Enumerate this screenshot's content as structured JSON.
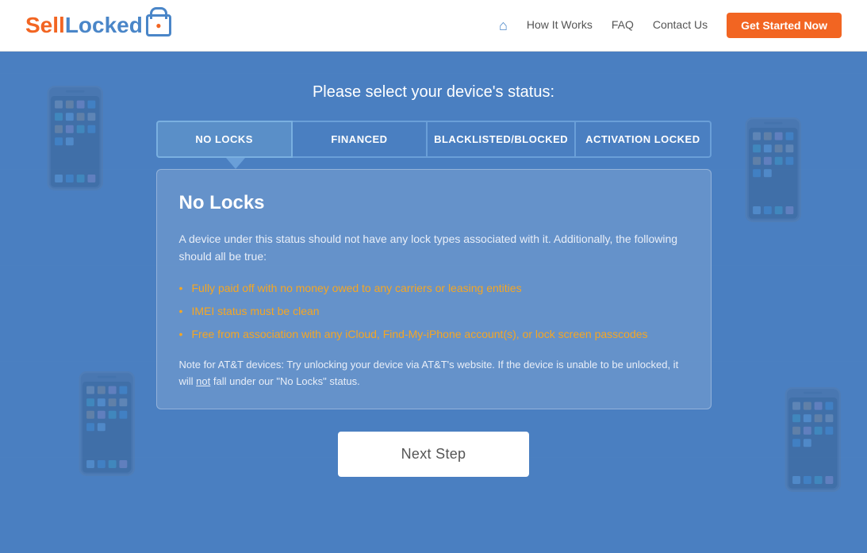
{
  "logo": {
    "sell": "Sell",
    "locked": "Locked"
  },
  "navbar": {
    "home_icon": "⌂",
    "how_it_works": "How It Works",
    "faq": "FAQ",
    "contact_us": "Contact Us",
    "get_started": "Get Started Now"
  },
  "main": {
    "page_title": "Please select your device's status:",
    "status_buttons": [
      {
        "label": "NO LOCKS",
        "active": true
      },
      {
        "label": "FINANCED",
        "active": false
      },
      {
        "label": "BLACKLISTED/BLOCKED",
        "active": false
      },
      {
        "label": "ACTIVATION LOCKED",
        "active": false
      }
    ],
    "card": {
      "title": "No Locks",
      "description": "A device under this status should not have any lock types associated with it. Additionally, the following should all be true:",
      "list_items": [
        "Fully paid off with no money owed to any carriers or leasing entities",
        "IMEI status must be clean",
        "Free from association with any iCloud, Find-My-iPhone account(s), or lock screen passcodes"
      ],
      "note": "Note for AT&T devices: Try unlocking your device via AT&T's website. If the device is unable to be unlocked, it will not fall under our \"No Locks\" status.",
      "note_underline": "not"
    },
    "next_step_button": "Next Step"
  }
}
